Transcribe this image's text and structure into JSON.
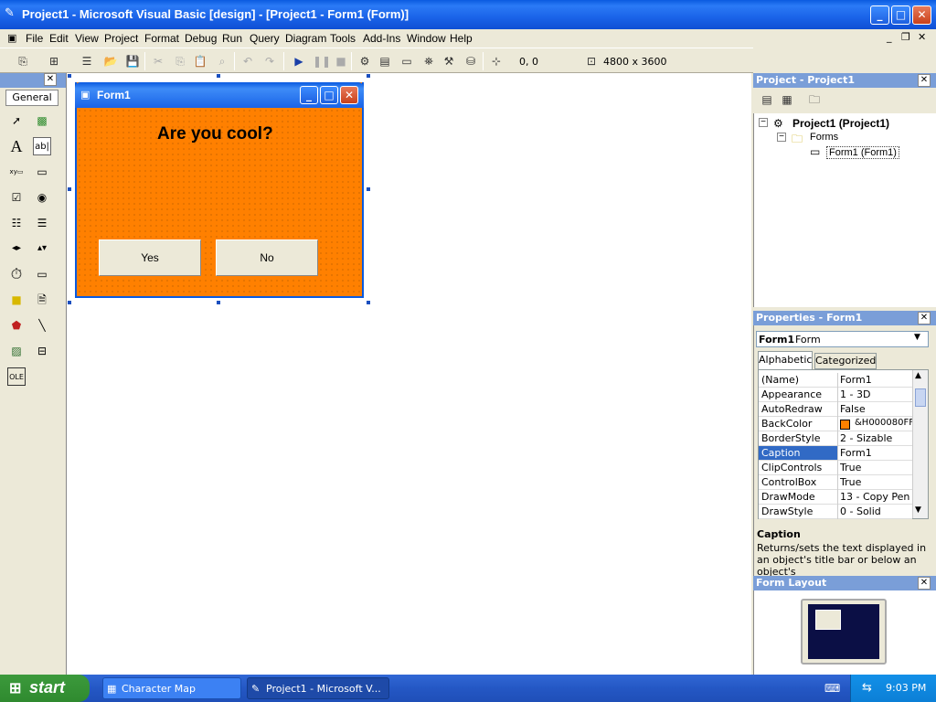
{
  "window": {
    "title": "Project1 - Microsoft Visual Basic [design] - [Project1 - Form1 (Form)]"
  },
  "menu": [
    "File",
    "Edit",
    "View",
    "Project",
    "Format",
    "Debug",
    "Run",
    "Query",
    "Diagram",
    "Tools",
    "Add-Ins",
    "Window",
    "Help"
  ],
  "toolbar": {
    "position": "0, 0",
    "size": "4800 x 3600"
  },
  "toolbox": {
    "tab_label": "General"
  },
  "form": {
    "title": "Form1",
    "label_text": "Are you cool?",
    "yes_button": "Yes",
    "no_button": "No",
    "backcolor": "#ff8000"
  },
  "project_explorer": {
    "title": "Project - Project1",
    "root": "Project1 (Project1)",
    "folder": "Forms",
    "item": "Form1 (Form1)"
  },
  "properties": {
    "title": "Properties - Form1",
    "object_name": "Form1",
    "object_type": "Form",
    "tabs": [
      "Alphabetic",
      "Categorized"
    ],
    "rows": [
      {
        "key": "(Name)",
        "value": "Form1"
      },
      {
        "key": "Appearance",
        "value": "1 - 3D"
      },
      {
        "key": "AutoRedraw",
        "value": "False"
      },
      {
        "key": "BackColor",
        "value": "&H000080FF"
      },
      {
        "key": "BorderStyle",
        "value": "2 - Sizable"
      },
      {
        "key": "Caption",
        "value": "Form1"
      },
      {
        "key": "ClipControls",
        "value": "True"
      },
      {
        "key": "ControlBox",
        "value": "True"
      },
      {
        "key": "DrawMode",
        "value": "13 - Copy Pen"
      },
      {
        "key": "DrawStyle",
        "value": "0 - Solid"
      }
    ],
    "selected_row": "Caption",
    "desc_title": "Caption",
    "desc_text": "Returns/sets the text displayed in an object's title bar or below an object's"
  },
  "form_layout": {
    "title": "Form Layout"
  },
  "taskbar": {
    "start": "start",
    "tasks": [
      "Character Map",
      "Project1 - Microsoft V..."
    ],
    "clock": "9:03 PM"
  }
}
